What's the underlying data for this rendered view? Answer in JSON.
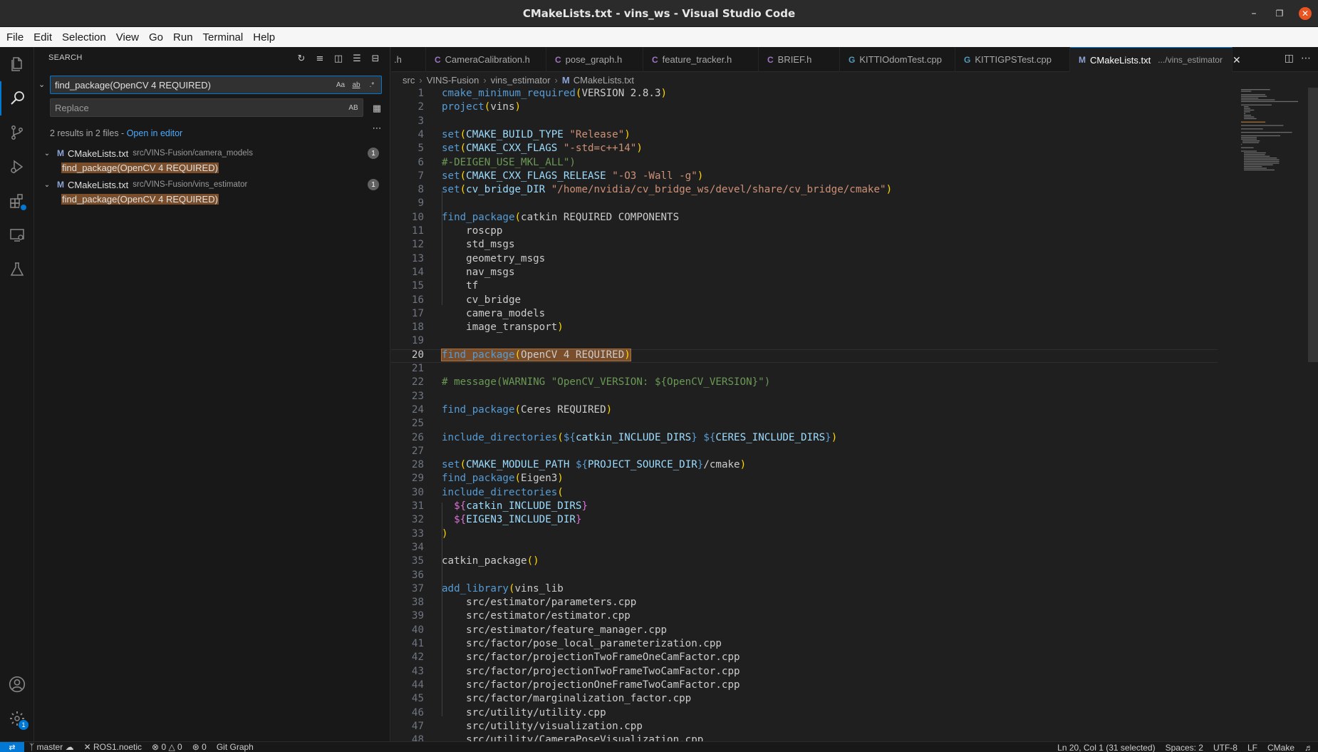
{
  "window": {
    "title": "CMakeLists.txt - vins_ws - Visual Studio Code"
  },
  "menu": [
    "File",
    "Edit",
    "Selection",
    "View",
    "Go",
    "Run",
    "Terminal",
    "Help"
  ],
  "sidebar": {
    "header": "SEARCH",
    "search_value": "find_package(OpenCV 4 REQUIRED)",
    "replace_placeholder": "Replace",
    "opt_case": "Aa",
    "opt_word": "ab",
    "opt_regex": ".*",
    "opt_preserve": "AB",
    "summary": "2 results in 2 files - ",
    "open_in_editor": "Open in editor",
    "results": [
      {
        "file": "CMakeLists.txt",
        "path": "src/VINS-Fusion/camera_models",
        "count": "1",
        "match": "find_package(OpenCV 4 REQUIRED)"
      },
      {
        "file": "CMakeLists.txt",
        "path": "src/VINS-Fusion/vins_estimator",
        "count": "1",
        "match": "find_package(OpenCV 4 REQUIRED)"
      }
    ]
  },
  "tabs": [
    {
      "label": ".h",
      "type": "c"
    },
    {
      "label": "CameraCalibration.h",
      "type": "c"
    },
    {
      "label": "pose_graph.h",
      "type": "c"
    },
    {
      "label": "feature_tracker.h",
      "type": "c"
    },
    {
      "label": "BRIEF.h",
      "type": "c"
    },
    {
      "label": "KITTIOdomTest.cpp",
      "type": "cpp"
    },
    {
      "label": "KITTIGPSTest.cpp",
      "type": "cpp"
    },
    {
      "label": "CMakeLists.txt",
      "sub": ".../vins_estimator",
      "type": "m"
    }
  ],
  "breadcrumb": [
    "src",
    "VINS-Fusion",
    "vins_estimator",
    "CMakeLists.txt"
  ],
  "editor": {
    "current_line": 20,
    "lines": [
      "<span class=\"f\">cmake_minimum_required</span><span class=\"p\">(</span>VERSION 2.8.3<span class=\"p\">)</span>",
      "<span class=\"f\">project</span><span class=\"p\">(</span>vins<span class=\"p\">)</span>",
      "",
      "<span class=\"f\">set</span><span class=\"p\">(</span><span class=\"v\">CMAKE_BUILD_TYPE</span> <span class=\"s\">\"Release\"</span><span class=\"p\">)</span>",
      "<span class=\"f\">set</span><span class=\"p\">(</span><span class=\"v\">CMAKE_CXX_FLAGS</span> <span class=\"s\">\"-std=c++14\"</span><span class=\"p\">)</span>",
      "<span class=\"cm\">#-DEIGEN_USE_MKL_ALL\")</span>",
      "<span class=\"f\">set</span><span class=\"p\">(</span><span class=\"v\">CMAKE_CXX_FLAGS_RELEASE</span> <span class=\"s\">\"-O3 -Wall -g\"</span><span class=\"p\">)</span>",
      "<span class=\"f\">set</span><span class=\"p\">(</span><span class=\"v\">cv_bridge_DIR</span> <span class=\"s\">\"/home/nvidia/cv_bridge_ws/devel/share/cv_bridge/cmake\"</span><span class=\"p\">)</span>",
      "",
      "<span class=\"f\">find_package</span><span class=\"p\">(</span>catkin REQUIRED COMPONENTS",
      "    roscpp",
      "    std_msgs",
      "    geometry_msgs",
      "    nav_msgs",
      "    tf",
      "    cv_bridge",
      "    camera_models",
      "    image_transport<span class=\"p\">)</span>",
      "",
      "<span class=\"hl\"><span class=\"f\">find_package</span><span class=\"p\">(</span>OpenCV 4 REQUIRED<span class=\"p\">)</span></span>",
      "",
      "<span class=\"cm\"># message(WARNING \"OpenCV_VERSION: ${OpenCV_VERSION}\")</span>",
      "",
      "<span class=\"f\">find_package</span><span class=\"p\">(</span>Ceres REQUIRED<span class=\"p\">)</span>",
      "",
      "<span class=\"f\">include_directories</span><span class=\"p\">(</span><span class=\"f\">${</span><span class=\"v\">catkin_INCLUDE_DIRS</span><span class=\"f\">}</span> <span class=\"f\">${</span><span class=\"v\">CERES_INCLUDE_DIRS</span><span class=\"f\">}</span><span class=\"p\">)</span>",
      "",
      "<span class=\"f\">set</span><span class=\"p\">(</span><span class=\"v\">CMAKE_MODULE_PATH</span> <span class=\"f\">${</span><span class=\"v\">PROJECT_SOURCE_DIR</span><span class=\"f\">}</span>/cmake<span class=\"p\">)</span>",
      "<span class=\"f\">find_package</span><span class=\"p\">(</span>Eigen3<span class=\"p\">)</span>",
      "<span class=\"f\">include_directories</span><span class=\"p\">(</span>",
      "  <span class=\"pu\">${</span><span class=\"v\">catkin_INCLUDE_DIRS</span><span class=\"pu\">}</span>",
      "  <span class=\"pu\">${</span><span class=\"v\">EIGEN3_INCLUDE_DIR</span><span class=\"pu\">}</span>",
      "<span class=\"p\">)</span>",
      "",
      "catkin_package<span class=\"p\">()</span>",
      "",
      "<span class=\"f\">add_library</span><span class=\"p\">(</span>vins_lib",
      "    src/estimator/parameters.cpp",
      "    src/estimator/estimator.cpp",
      "    src/estimator/feature_manager.cpp",
      "    src/factor/pose_local_parameterization.cpp",
      "    src/factor/projectionTwoFrameOneCamFactor.cpp",
      "    src/factor/projectionTwoFrameTwoCamFactor.cpp",
      "    src/factor/projectionOneFrameTwoCamFactor.cpp",
      "    src/factor/marginalization_factor.cpp",
      "    src/utility/utility.cpp",
      "    src/utility/visualization.cpp",
      "    src/utility/CameraPoseVisualization.cpp"
    ]
  },
  "status": {
    "branch": "master",
    "ros": "ROS1.noetic",
    "errors": "0",
    "warnings": "0",
    "ports": "0",
    "git_graph": "Git Graph",
    "position": "Ln 20, Col 1 (31 selected)",
    "spaces": "Spaces: 2",
    "encoding": "UTF-8",
    "eol": "LF",
    "language": "CMake"
  },
  "colors": {
    "accent": "#0078d4",
    "match_highlight": "#7a4e2a",
    "close_button": "#e95420"
  }
}
